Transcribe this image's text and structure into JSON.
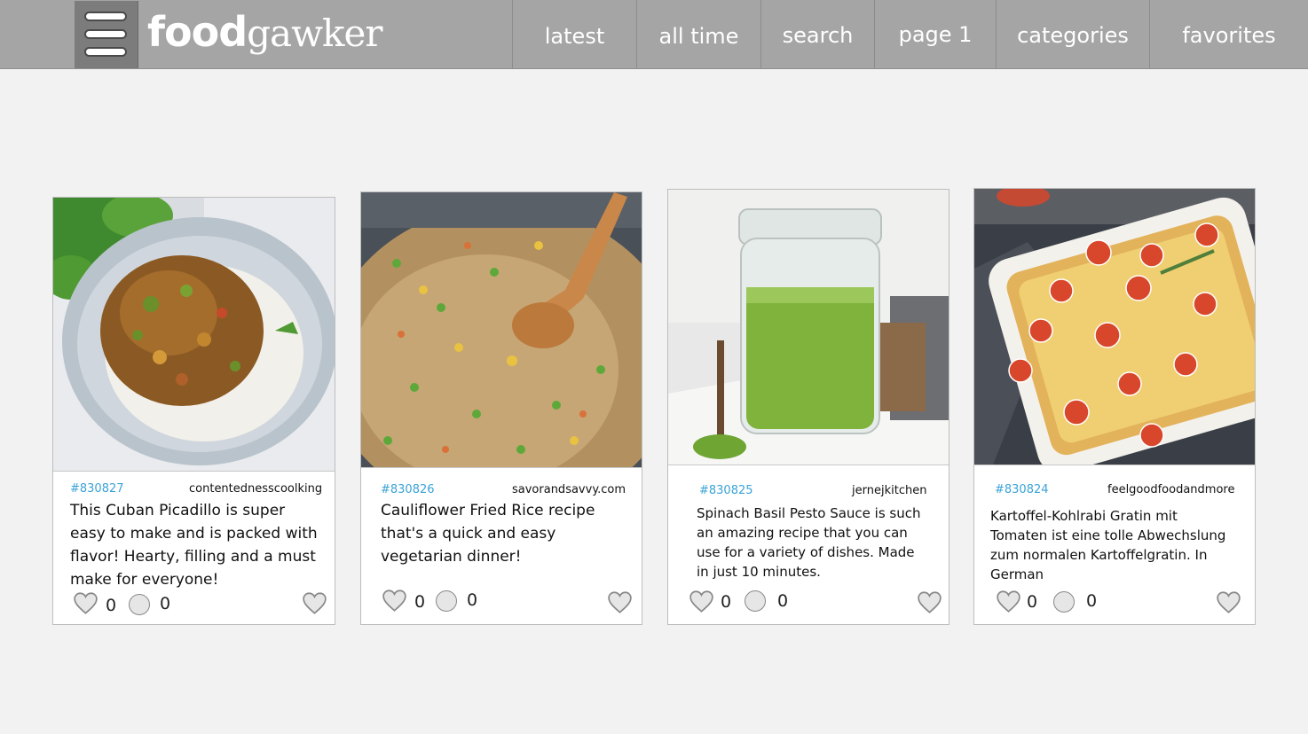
{
  "header": {
    "logo_bold": "food",
    "logo_light": "gawker",
    "nav": [
      "latest",
      "all time",
      "search",
      "page 1",
      "categories",
      "favorites"
    ]
  },
  "icons": {
    "menu": "hamburger-menu-icon",
    "like": "heart-icon",
    "comment": "circle-icon",
    "favorite": "heart-icon"
  },
  "colors": {
    "topbar": "#a5a5a5",
    "menu_button": "#7c7c7c",
    "recipe_id": "#3aa2d6",
    "background": "#f2f2f2"
  },
  "cards": [
    {
      "id": "#830827",
      "source": "contentednesscoolking",
      "text": "This Cuban Picadillo is super easy to make and is packed with flavor! Hearty, filling and a must make for everyone!",
      "likes": "0",
      "comments": "0"
    },
    {
      "id": "#830826",
      "source": "savorandsavvy.com",
      "text": "Cauliflower Fried Rice recipe that's a quick and easy vegetarian dinner!",
      "likes": "0",
      "comments": "0"
    },
    {
      "id": "#830825",
      "source": "jernejkitchen",
      "text": "Spinach Basil Pesto Sauce is such an amazing recipe that you can use for a variety of dishes. Made in just 10 minutes.",
      "likes": "0",
      "comments": "0"
    },
    {
      "id": "#830824",
      "source": "feelgoodfoodandmore",
      "text": "Kartoffel-Kohlrabi Gratin mit Tomaten ist eine tolle Abwechslung zum normalen Kartoffelgratin. In German",
      "likes": "0",
      "comments": "0"
    }
  ]
}
